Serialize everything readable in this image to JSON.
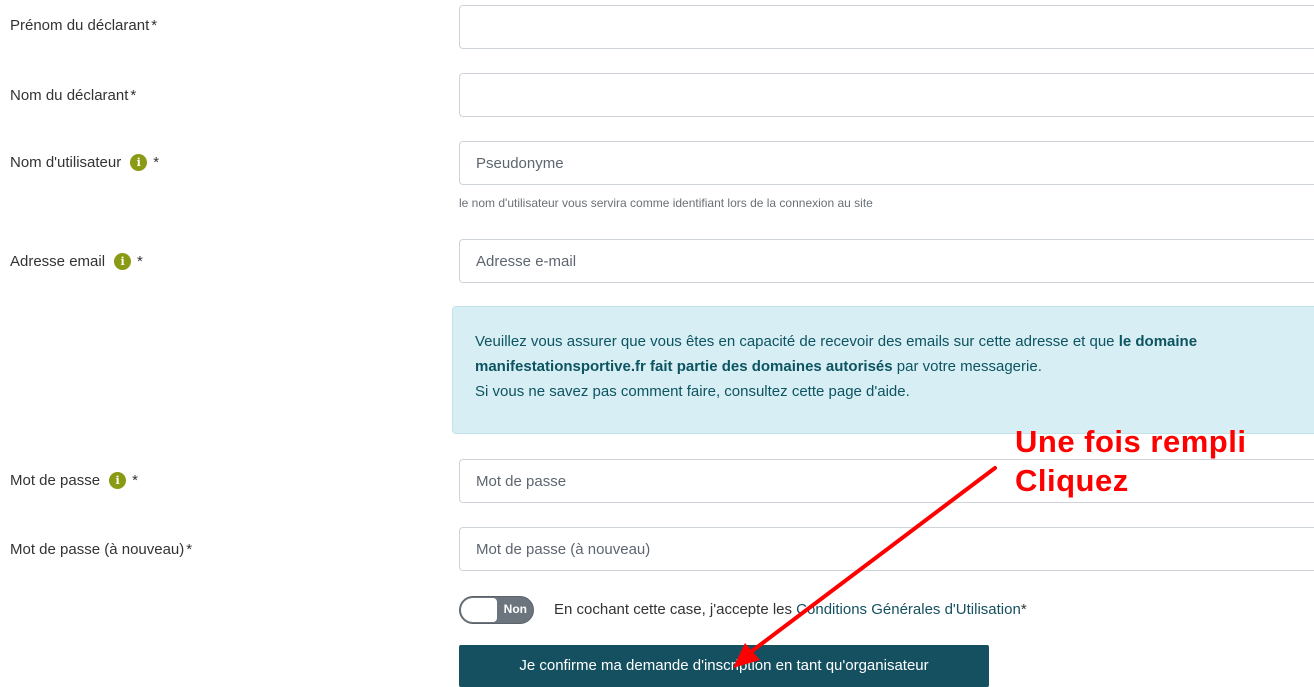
{
  "form": {
    "prenom": {
      "label": "Prénom du déclarant",
      "asterisk": "*",
      "value": "",
      "placeholder": ""
    },
    "nom": {
      "label": "Nom du déclarant",
      "asterisk": "*",
      "value": "",
      "placeholder": ""
    },
    "username": {
      "label": "Nom d'utilisateur",
      "info_icon": "info-icon",
      "asterisk": "*",
      "value": "",
      "placeholder": "Pseudonyme",
      "help": "le nom d'utilisateur vous servira comme identifiant lors de la connexion au site"
    },
    "email": {
      "label": "Adresse email",
      "info_icon": "info-icon",
      "asterisk": "*",
      "value": "",
      "placeholder": "Adresse e-mail"
    },
    "password": {
      "label": "Mot de passe",
      "info_icon": "info-icon",
      "asterisk": "*",
      "value": "",
      "placeholder": "Mot de passe"
    },
    "password_confirm": {
      "label": "Mot de passe (à nouveau)",
      "asterisk": "*",
      "value": "",
      "placeholder": "Mot de passe (à nouveau)"
    }
  },
  "alert": {
    "text_part1": "Veuillez vous assurer que vous êtes en capacité de recevoir des emails sur cette adresse et que ",
    "text_bold": "le domaine manifestationsportive.fr fait partie des domaines autorisés",
    "text_part2": " par votre messagerie.",
    "line2": "Si vous ne savez pas comment faire, consultez cette page d'aide."
  },
  "cgu": {
    "toggle_label": "Non",
    "text": "En cochant cette case, j'accepte les ",
    "link": "Conditions Générales d'Utilisation",
    "asterisk": "*"
  },
  "submit_label": "Je confirme ma demande d'inscription en tant qu'organisateur",
  "annotation": {
    "line1": "Une fois rempli",
    "line2": "Cliquez"
  },
  "colors": {
    "accent": "#14505f",
    "info_icon": "#8a9a13",
    "alert_bg": "#d8eef5",
    "annotation": "#ff0000",
    "toggle_off": "#6c757d"
  }
}
